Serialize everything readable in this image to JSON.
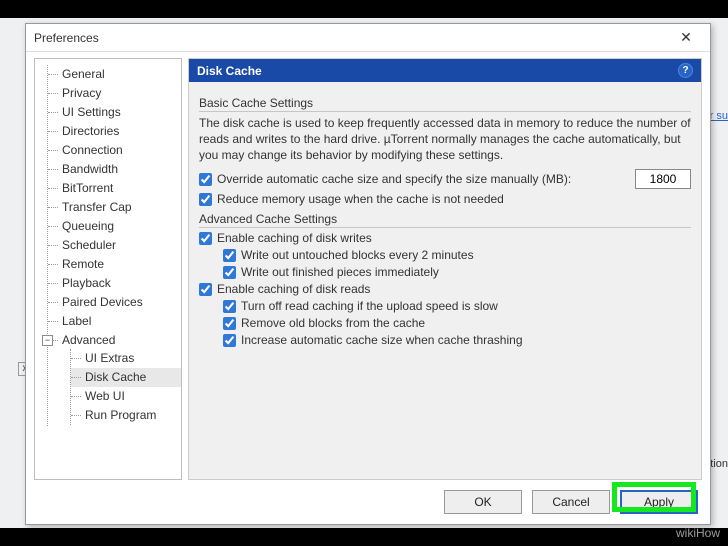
{
  "bg": {
    "hint": "our su",
    "close_x": "x",
    "text": "ation"
  },
  "dialog": {
    "title": "Preferences",
    "close": "✕"
  },
  "tree": {
    "items": [
      "General",
      "Privacy",
      "UI Settings",
      "Directories",
      "Connection",
      "Bandwidth",
      "BitTorrent",
      "Transfer Cap",
      "Queueing",
      "Scheduler",
      "Remote",
      "Playback",
      "Paired Devices",
      "Label"
    ],
    "adv_label": "Advanced",
    "adv_expander": "−",
    "adv_children": [
      "UI Extras",
      "Disk Cache",
      "Web UI",
      "Run Program"
    ],
    "selected": "Disk Cache"
  },
  "panel": {
    "title": "Disk Cache",
    "help": "?",
    "basic": {
      "group": "Basic Cache Settings",
      "desc": "The disk cache is used to keep frequently accessed data in memory to reduce the number of reads and writes to the hard drive. µTorrent normally manages the cache automatically, but you may change its behavior by modifying these settings.",
      "override": "Override automatic cache size and specify the size manually (MB):",
      "override_val": "1800",
      "reduce": "Reduce memory usage when the cache is not needed"
    },
    "adv": {
      "group": "Advanced Cache Settings",
      "writes": "Enable caching of disk writes",
      "w1": "Write out untouched blocks every 2 minutes",
      "w2": "Write out finished pieces immediately",
      "reads": "Enable caching of disk reads",
      "r1": "Turn off read caching if the upload speed is slow",
      "r2": "Remove old blocks from the cache",
      "r3": "Increase automatic cache size when cache thrashing"
    }
  },
  "buttons": {
    "ok": "OK",
    "cancel": "Cancel",
    "apply": "Apply"
  },
  "watermark": "wikiHow"
}
